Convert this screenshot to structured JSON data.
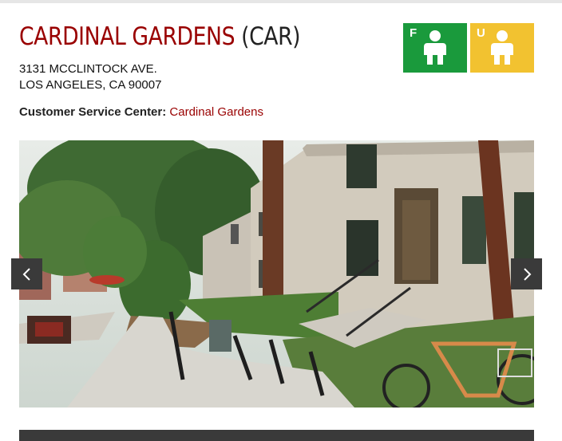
{
  "page": {
    "title_name": "CARDINAL GARDENS",
    "title_code": "(CAR)",
    "address_line1": "3131 MCCLINTOCK AVE.",
    "address_line2": "LOS ANGELES, CA 90007",
    "csc_label": "Customer Service Center:",
    "csc_link": "Cardinal Gardens"
  },
  "badges": [
    {
      "letter": "F",
      "color": "#1a9a3c",
      "icon": "person-icon"
    },
    {
      "letter": "U",
      "color": "#f2c230",
      "icon": "person-icon"
    }
  ],
  "carousel": {
    "prev_icon": "chevron-left-icon",
    "next_icon": "chevron-right-icon"
  },
  "colors": {
    "brand": "#990000",
    "nav_bg": "#3a3a3a"
  }
}
